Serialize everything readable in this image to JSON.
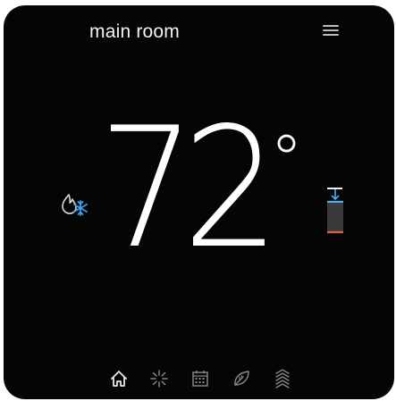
{
  "header": {
    "room_name": "main room",
    "menu_icon": "hamburger-menu-icon"
  },
  "display": {
    "temperature": "72",
    "unit_symbol": "°"
  },
  "mode": {
    "icon": "heat-cool-icon",
    "heat_color": "#d9d9d9",
    "cool_color": "#3aa0e8"
  },
  "setpoint_gauge": {
    "icon": "setpoint-gauge-icon",
    "cool_color": "#4ab0f0",
    "heat_color": "#d8603a"
  },
  "nav": {
    "items": [
      {
        "icon": "home-icon",
        "active": true
      },
      {
        "icon": "fan-icon",
        "active": false
      },
      {
        "icon": "schedule-calendar-icon",
        "active": false
      },
      {
        "icon": "eco-leaf-icon",
        "active": false
      },
      {
        "icon": "humidity-waves-icon",
        "active": false
      }
    ]
  },
  "colors": {
    "background": "#050505",
    "text": "#ffffff",
    "icon_active": "#e8e8e8",
    "icon_inactive": "#8a8a8a"
  }
}
